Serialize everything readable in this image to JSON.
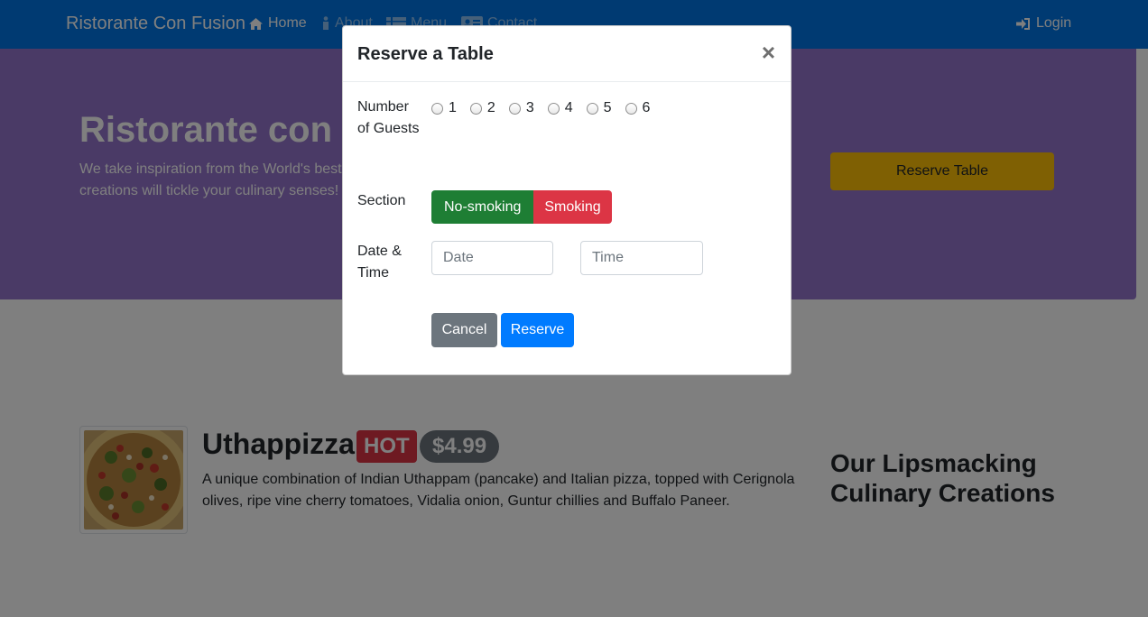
{
  "colors": {
    "navbar_bg": "#0074e4",
    "jumbotron_bg": "#9575cd",
    "reserve_table_btn": "#ffc107",
    "no_smoking": "#1e7e34",
    "smoking": "#dc3545",
    "cancel": "#6c757d",
    "reserve": "#007bff",
    "hot_badge": "#dc3545",
    "price_badge": "#6c757d"
  },
  "navbar": {
    "brand": "Ristorante Con Fusion",
    "items": [
      {
        "label": "Home",
        "icon": "home-icon"
      },
      {
        "label": "About",
        "icon": "info-icon"
      },
      {
        "label": "Menu",
        "icon": "list-icon"
      },
      {
        "label": "Contact",
        "icon": "address-card-icon"
      }
    ],
    "login": {
      "label": "Login",
      "icon": "sign-in-icon"
    }
  },
  "jumbotron": {
    "title": "Ristorante con Fusion",
    "text": "We take inspiration from the World's best cuisines, and create a unique fusion experience. Our lipsmacking creations will tickle your culinary senses!",
    "reserve_button": "Reserve Table"
  },
  "featured": {
    "name": "Uthappizza",
    "badge_hot": "HOT",
    "price": "$4.99",
    "description": "A unique combination of Indian Uthappam (pancake) and Italian pizza, topped with Cerignola olives, ripe vine cherry tomatoes, Vidalia onion, Guntur chillies and Buffalo Paneer.",
    "image_icon": "pizza-image"
  },
  "side_heading": "Our Lipsmacking Culinary Creations",
  "modal": {
    "title": "Reserve a Table",
    "close": "×",
    "guests_label": "Number of Guests",
    "guest_options": [
      "1",
      "2",
      "3",
      "4",
      "5",
      "6"
    ],
    "section_label": "Section",
    "section_options": [
      "No-smoking",
      "Smoking"
    ],
    "datetime_label": "Date & Time",
    "date_placeholder": "Date",
    "time_placeholder": "Time",
    "cancel_label": "Cancel",
    "reserve_label": "Reserve"
  }
}
